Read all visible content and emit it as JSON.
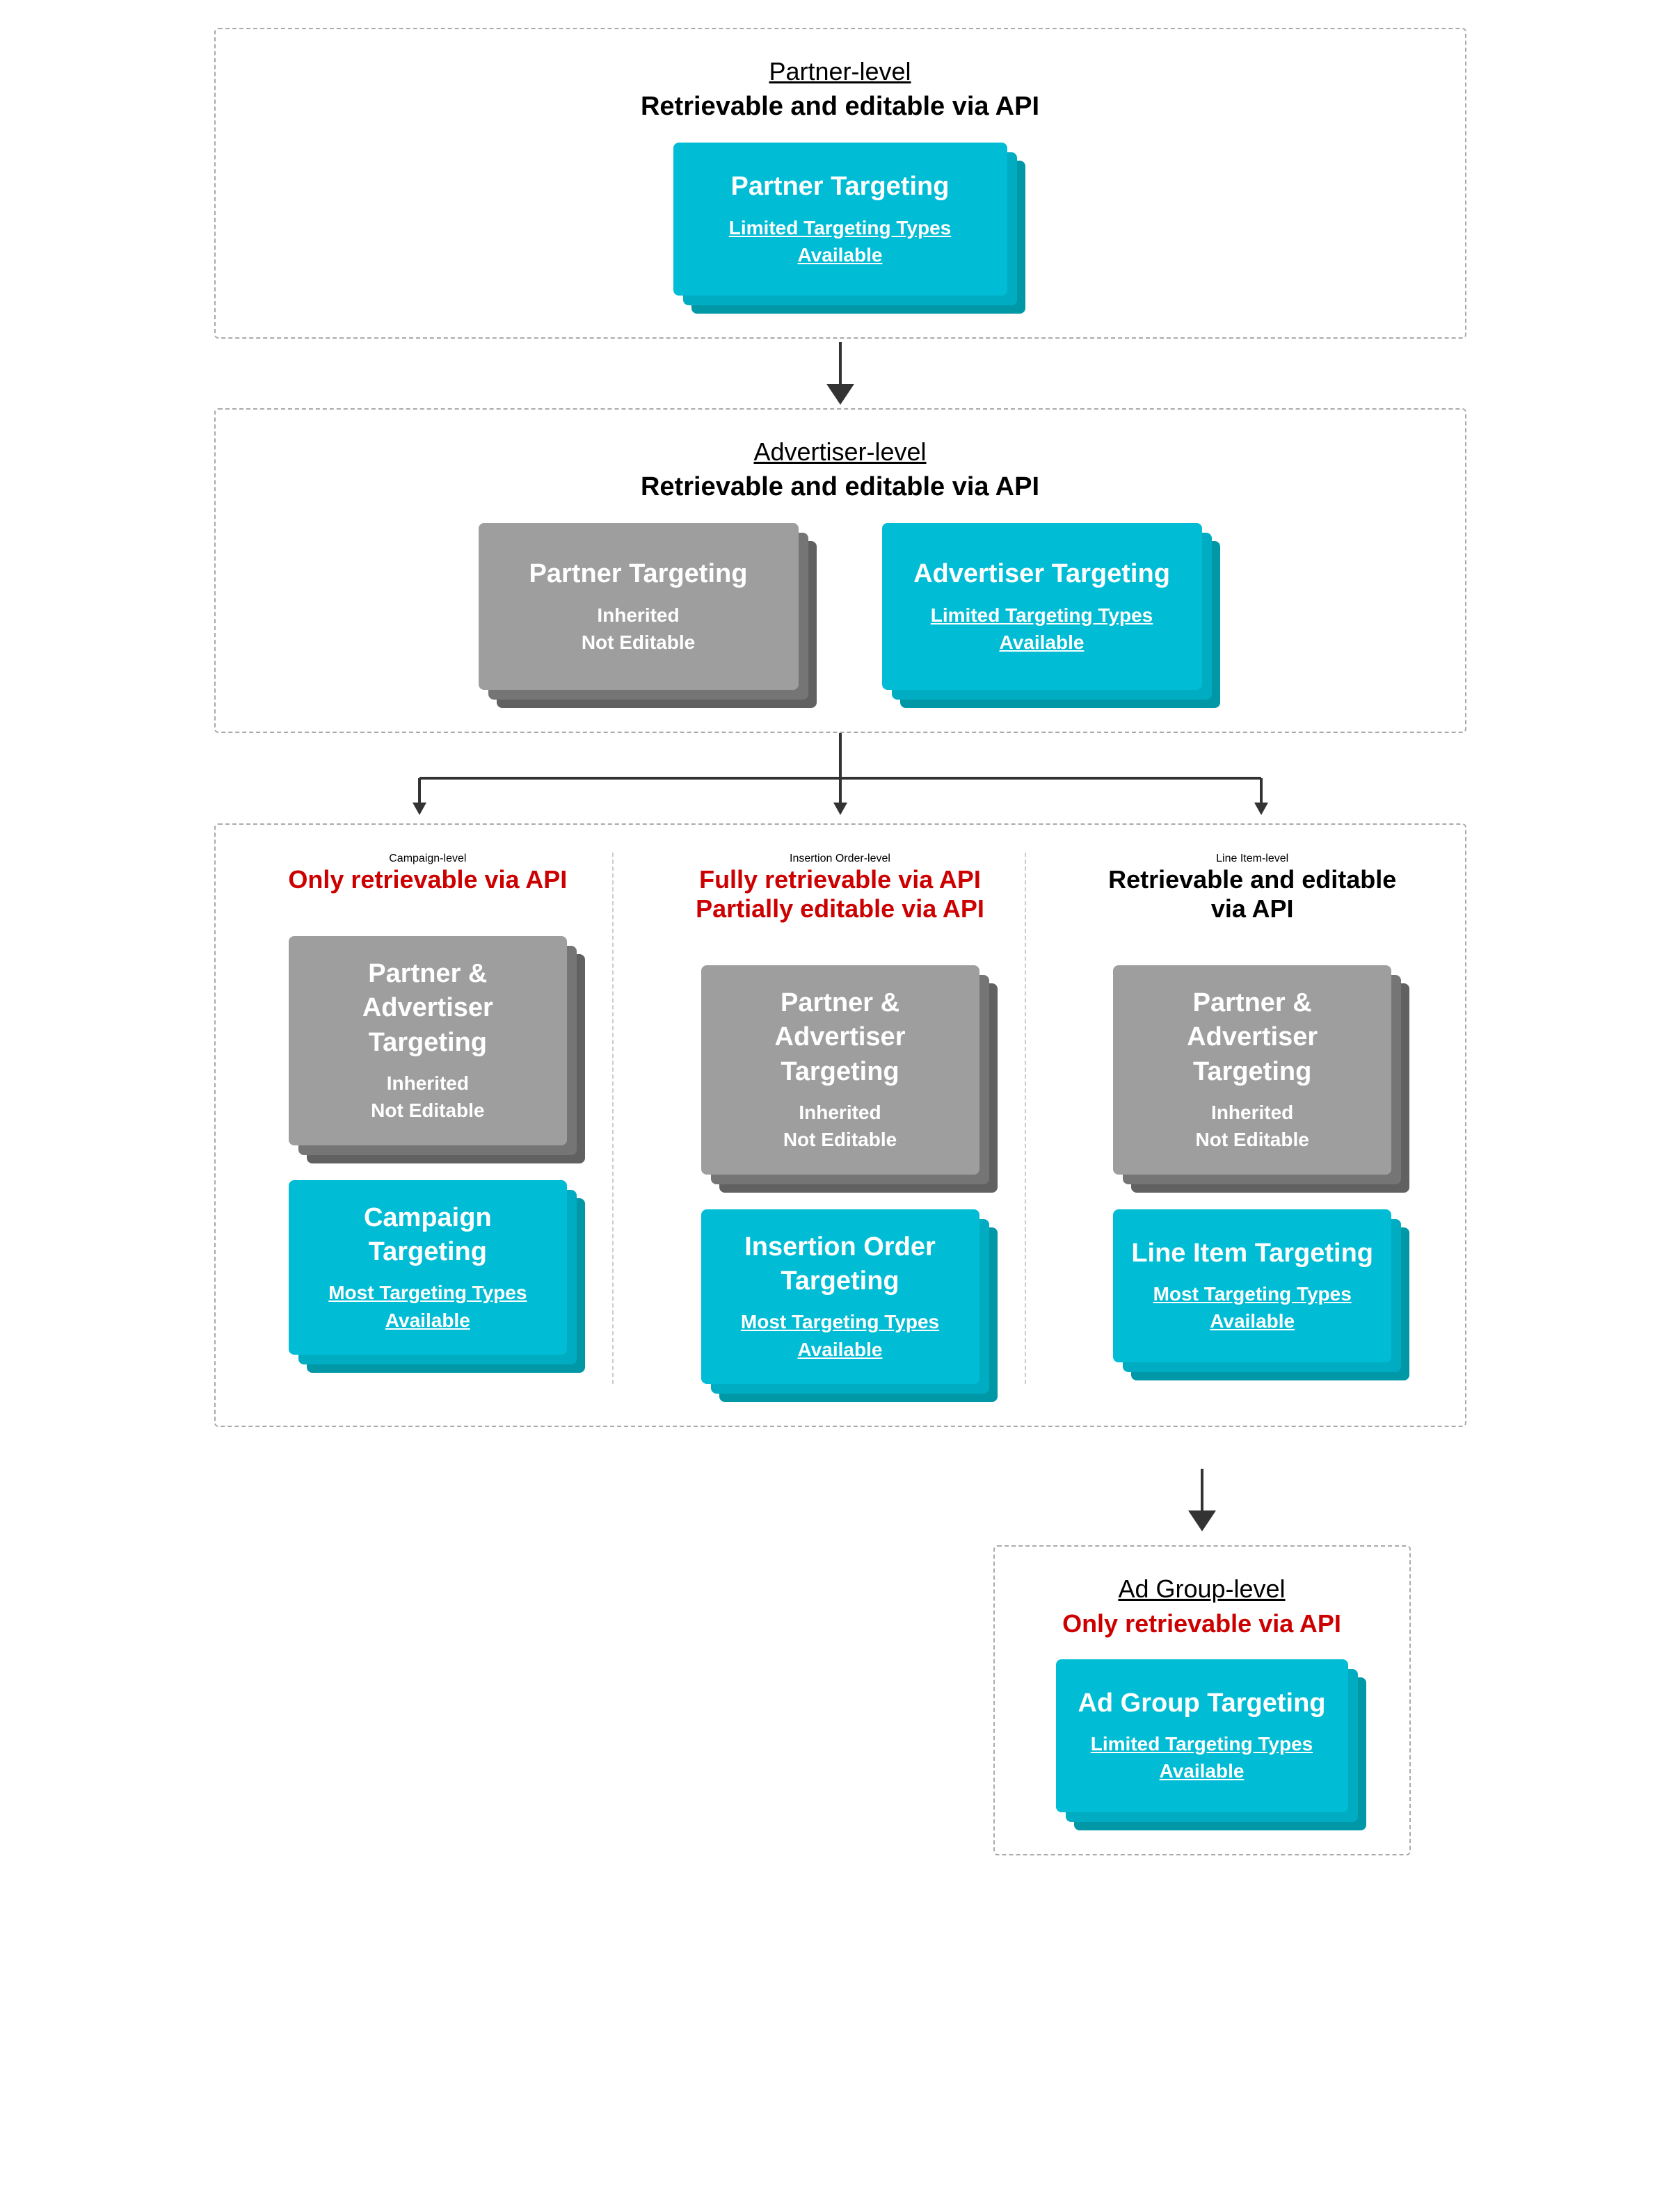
{
  "partner_level": {
    "title": "Partner-level",
    "desc": "Retrievable and editable via API",
    "desc_color": "black",
    "card": {
      "title": "Partner Targeting",
      "link1": "Limited Targeting Types",
      "link2": "Available",
      "type": "teal"
    }
  },
  "advertiser_level": {
    "title": "Advertiser-level",
    "desc": "Retrievable and editable via API",
    "desc_color": "black",
    "cards": [
      {
        "title": "Partner Targeting",
        "subtitle1": "Inherited",
        "subtitle2": "Not Editable",
        "type": "gray"
      },
      {
        "title": "Advertiser Targeting",
        "link1": "Limited Targeting Types",
        "link2": "Available",
        "type": "teal"
      }
    ]
  },
  "campaign_level": {
    "title": "Campaign-level",
    "desc": "Only retrievable via API",
    "desc_color": "red",
    "cards": [
      {
        "title": "Partner & Advertiser Targeting",
        "subtitle1": "Inherited",
        "subtitle2": "Not Editable",
        "type": "gray"
      },
      {
        "title": "Campaign Targeting",
        "link1": "Most Targeting Types",
        "link2": "Available",
        "type": "teal"
      }
    ]
  },
  "io_level": {
    "title": "Insertion Order-level",
    "desc1": "Fully retrievable via API",
    "desc2": "Partially editable via API",
    "desc_color": "red",
    "cards": [
      {
        "title": "Partner & Advertiser Targeting",
        "subtitle1": "Inherited",
        "subtitle2": "Not Editable",
        "type": "gray"
      },
      {
        "title": "Insertion Order Targeting",
        "link1": "Most Targeting Types",
        "link2": "Available",
        "type": "teal"
      }
    ]
  },
  "lineitem_level": {
    "title": "Line Item-level",
    "desc": "Retrievable and editable via API",
    "desc_color": "black",
    "cards": [
      {
        "title": "Partner & Advertiser Targeting",
        "subtitle1": "Inherited",
        "subtitle2": "Not Editable",
        "type": "gray"
      },
      {
        "title": "Line Item Targeting",
        "link1": "Most Targeting Types",
        "link2": "Available",
        "type": "teal"
      }
    ]
  },
  "adgroup_level": {
    "title": "Ad Group-level",
    "desc": "Only retrievable via API",
    "desc_color": "red",
    "card": {
      "title": "Ad Group Targeting",
      "link1": "Limited Targeting Types",
      "link2": "Available",
      "type": "teal"
    }
  }
}
